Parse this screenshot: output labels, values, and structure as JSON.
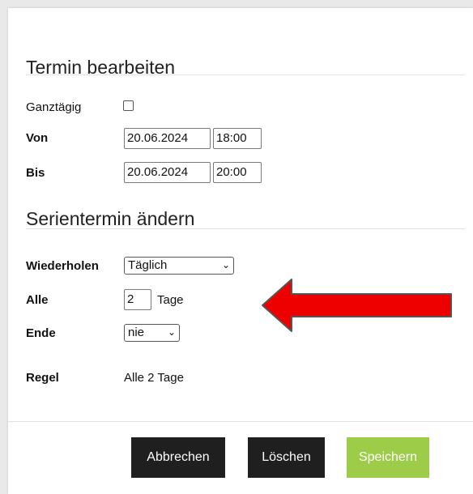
{
  "section1": {
    "title": "Termin bearbeiten"
  },
  "allday": {
    "label": "Ganztägig",
    "checked": false
  },
  "from": {
    "label": "Von",
    "date": "20.06.2024",
    "time": "18:00"
  },
  "to": {
    "label": "Bis",
    "date": "20.06.2024",
    "time": "20:00"
  },
  "section2": {
    "title": "Serientermin ändern"
  },
  "repeat": {
    "label": "Wiederholen",
    "value": "Täglich"
  },
  "every": {
    "label": "Alle",
    "value": "2",
    "unit": "Tage"
  },
  "end": {
    "label": "Ende",
    "value": "nie"
  },
  "rule": {
    "label": "Regel",
    "value": "Alle 2 Tage"
  },
  "buttons": {
    "cancel": "Abbrechen",
    "delete": "Löschen",
    "save": "Speichern"
  },
  "colors": {
    "save": "#9ccc48",
    "dark_button": "#1f1f1f",
    "arrow": "#ee0000"
  }
}
